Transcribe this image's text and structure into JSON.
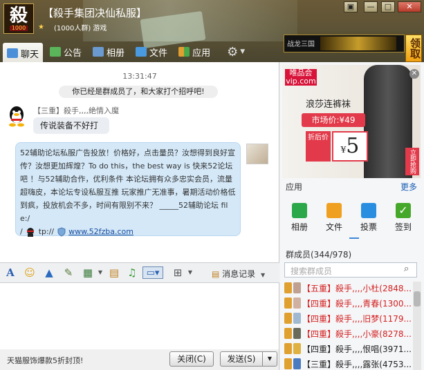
{
  "header": {
    "avatar_glyph": "殺",
    "avatar_num": "1000",
    "group_name": "【殺手集团决仙私服】",
    "group_meta": "(1000人群) 游戏",
    "game_label": "战龙三国",
    "claim_label": "领取",
    "window_controls": [
      "▣",
      "—",
      "□",
      "✕"
    ]
  },
  "tabs": [
    {
      "label": "聊天",
      "icon": "chat-icon",
      "color": "#4a8fd8"
    },
    {
      "label": "公告",
      "icon": "announce-icon",
      "color": "#5ab45a"
    },
    {
      "label": "相册",
      "icon": "album-icon",
      "color": "#6a9ad0"
    },
    {
      "label": "文件",
      "icon": "folder-icon",
      "color": "#4a9ae0"
    },
    {
      "label": "应用",
      "icon": "apps-icon",
      "color": "#e0a030"
    },
    {
      "label": "",
      "icon": "gear-icon",
      "color": "#dddddd"
    }
  ],
  "chat": {
    "time": "13:31:47",
    "system_msg": "你已经是群成员了，和大家打个招呼吧!",
    "sender": "【三重】殺手,,,,絶情入魔",
    "message": "传说装备不好打",
    "ad_msg": "52辅助论坛私服广告投放！价格好，点击量员？汝想得到良好宣传？汝想更加辉煌？To do this，the best way is 快来52论坛吧 ！与52辅助合作，优利条件 本论坛拥有众多忠实会员，流量超嗨皮，本论坛专设私服互推 玩家推广无准事，暑期活动价格低到疯，投放机会不多，时间有限别不来？ _____52辅助论坛  file:/",
    "ad_tail_prefix": "/",
    "ad_tail_mid": "tp://",
    "ad_link": "www.52fzba.com"
  },
  "toolbar": {
    "icons": [
      "font-icon",
      "emoji-icon",
      "shake-icon",
      "note-icon",
      "image-icon",
      "doc-icon",
      "music-icon",
      "screen-icon",
      "plus-icon"
    ],
    "history_label": "消息记录"
  },
  "bottom": {
    "promo": "天猫服饰爆款5折封顶!",
    "close_label": "关闭(C)",
    "send_label": "发送(S)"
  },
  "sidebar": {
    "vip_logo": "唯品会\nvip.com",
    "product": "浪莎连裤袜",
    "market_price": "市场价:¥49",
    "discount_tag": "折后价",
    "discount_price": "5",
    "currency": "¥",
    "buy_label": "立即抢购",
    "apps_title": "应用",
    "apps_more": "更多",
    "apps": [
      {
        "label": "相册",
        "icon": "album-app-icon",
        "color": "#2aa84a"
      },
      {
        "label": "文件",
        "icon": "file-app-icon",
        "color": "#f0a020"
      },
      {
        "label": "投票",
        "icon": "vote-app-icon",
        "color": "#2a8ee0"
      },
      {
        "label": "签到",
        "icon": "checkin-app-icon",
        "color": "#46a82a"
      }
    ],
    "members_title": "群成员(344/978)",
    "search_placeholder": "搜索群成员",
    "members": [
      {
        "rank": "【五重】",
        "name": "殺手,,,,小杜(2848...",
        "red": true
      },
      {
        "rank": "【四重】",
        "name": "殺手,,,,青春(1300...",
        "red": true
      },
      {
        "rank": "【四重】",
        "name": "殺手,,,,旧梦(1179...",
        "red": true
      },
      {
        "rank": "【四重】",
        "name": "殺手,,,,小豪(8278...",
        "red": true
      },
      {
        "rank": "【四重】",
        "name": "殺手,,,,恨唱(3971...",
        "red": false
      },
      {
        "rank": "【三重】",
        "name": "殺手,,,,露张(4753...",
        "red": false
      }
    ]
  }
}
